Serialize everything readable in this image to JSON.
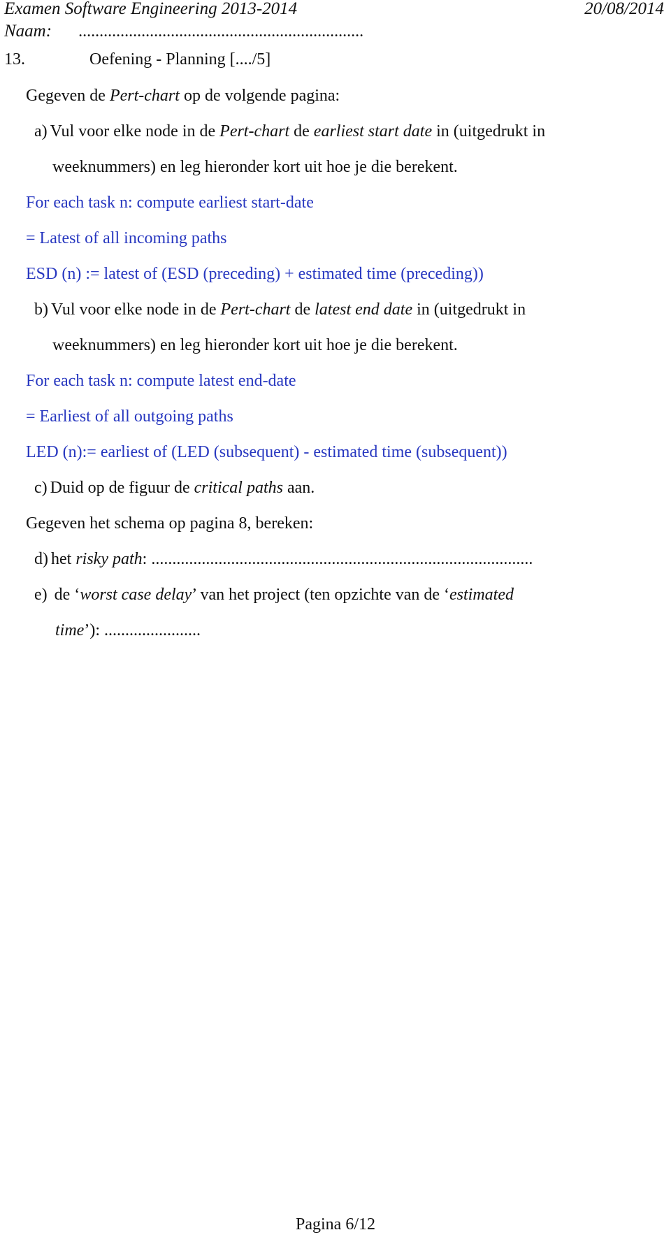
{
  "header": {
    "title": "Examen Software Engineering 2013-2014",
    "date": "20/08/2014",
    "name_label": "Naam:",
    "name_blank": "...................................................................."
  },
  "exercise": {
    "number": "13.",
    "title": "Oefening - Planning [..../5]"
  },
  "intro": {
    "pre": "Gegeven de ",
    "em": "Pert-chart",
    "post": " op de volgende pagina:"
  },
  "question_a": {
    "marker": "a)",
    "t1": "Vul voor elke node in de ",
    "em1": "Pert-chart",
    "t2": " de ",
    "em2": "earliest start date",
    "t3": " in (uitgedrukt in",
    "line2": "weeknummers) en leg hieronder kort uit hoe je die berekent."
  },
  "answer_a": [
    "For each task n: compute earliest start-date",
    "= Latest of all incoming paths",
    "ESD (n) := latest of (ESD (preceding) + estimated time (preceding))"
  ],
  "question_b": {
    "marker": "b)",
    "t1": "Vul voor elke node in de ",
    "em1": "Pert-chart",
    "t2": " de ",
    "em2": "latest end date",
    "t3": " in (uitgedrukt in",
    "line2": "weeknummers) en leg hieronder kort uit hoe je die berekent."
  },
  "answer_b": [
    "For each task n: compute latest end-date",
    "= Earliest of all outgoing paths",
    "LED (n):= earliest of (LED (subsequent) - estimated time (subsequent))"
  ],
  "question_c": {
    "marker": "c)",
    "t1": "Duid op de figuur de ",
    "em1": "critical paths",
    "t2": " aan."
  },
  "intro2": "Gegeven het schema op pagina 8, bereken:",
  "question_d": {
    "marker": "d)",
    "t1": "het ",
    "em1": "risky path",
    "t2": ": ",
    "blank": "..........................................................................................."
  },
  "question_e": {
    "marker": "e)",
    "t1": "de ‘",
    "em1": "worst case delay",
    "t2": "’ van het project (ten opzichte van de ‘",
    "em2": "estimated",
    "em3": "time",
    "t3": "’): ",
    "blank": "......................."
  },
  "footer": {
    "page": "Pagina 6/12"
  },
  "colors": {
    "answer_text": "#2838c0",
    "body_text": "#111111"
  }
}
